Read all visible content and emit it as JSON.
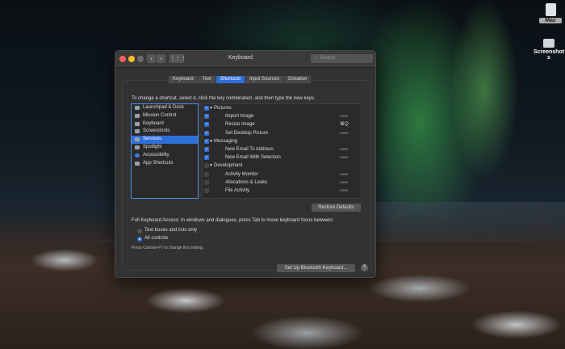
{
  "desktop": {
    "icons": [
      {
        "label": "Mac"
      },
      {
        "label": "Screenshots"
      }
    ]
  },
  "window": {
    "title": "Keyboard",
    "search_placeholder": "Search",
    "tabs": [
      "Keyboard",
      "Text",
      "Shortcuts",
      "Input Sources",
      "Dictation"
    ],
    "active_tab": "Shortcuts",
    "instruction": "To change a shortcut, select it, click the key combination, and then type the new keys.",
    "categories": [
      {
        "label": "Launchpad & Dock",
        "icon": "launchpad-icon"
      },
      {
        "label": "Mission Control",
        "icon": "mission-control-icon"
      },
      {
        "label": "Keyboard",
        "icon": "keyboard-icon"
      },
      {
        "label": "Screenshots",
        "icon": "screenshots-icon"
      },
      {
        "label": "Services",
        "icon": "services-icon",
        "selected": true
      },
      {
        "label": "Spotlight",
        "icon": "spotlight-icon"
      },
      {
        "label": "Accessibility",
        "icon": "accessibility-icon"
      },
      {
        "label": "App Shortcuts",
        "icon": "app-shortcuts-icon"
      }
    ],
    "shortcuts": [
      {
        "type": "group",
        "name": "Pictures",
        "checked": true
      },
      {
        "type": "item",
        "name": "Import Image",
        "checked": true,
        "shortcut": "none"
      },
      {
        "type": "item",
        "name": "Resize Image",
        "checked": true,
        "shortcut": "⌘Q"
      },
      {
        "type": "item",
        "name": "Set Desktop Picture",
        "checked": true,
        "shortcut": "none"
      },
      {
        "type": "group",
        "name": "Messaging",
        "checked": true
      },
      {
        "type": "item",
        "name": "New Email To Address",
        "checked": true,
        "shortcut": "none"
      },
      {
        "type": "item",
        "name": "New Email With Selection",
        "checked": true,
        "shortcut": "none"
      },
      {
        "type": "group",
        "name": "Development",
        "checked": false
      },
      {
        "type": "item",
        "name": "Activity Monitor",
        "checked": false,
        "shortcut": "none"
      },
      {
        "type": "item",
        "name": "Allocations & Leaks",
        "checked": false,
        "shortcut": "none"
      },
      {
        "type": "item",
        "name": "File Activity",
        "checked": false,
        "shortcut": "none"
      }
    ],
    "restore_defaults": "Restore Defaults",
    "full_keyboard_access": "Full Keyboard Access: In windows and dialogues, press Tab to move keyboard focus between:",
    "radio_options": [
      {
        "label": "Text boxes and lists only",
        "selected": false
      },
      {
        "label": "All controls",
        "selected": true
      }
    ],
    "note": "Press Control+F7 to change this setting.",
    "bluetooth_button": "Set Up Bluetooth Keyboard...",
    "help": "?"
  },
  "colors": {
    "accent": "#2f6fd8",
    "window_bg": "#323232",
    "close": "#ff5f57",
    "minimize": "#febc2e",
    "zoom": "#6b6b6b"
  }
}
